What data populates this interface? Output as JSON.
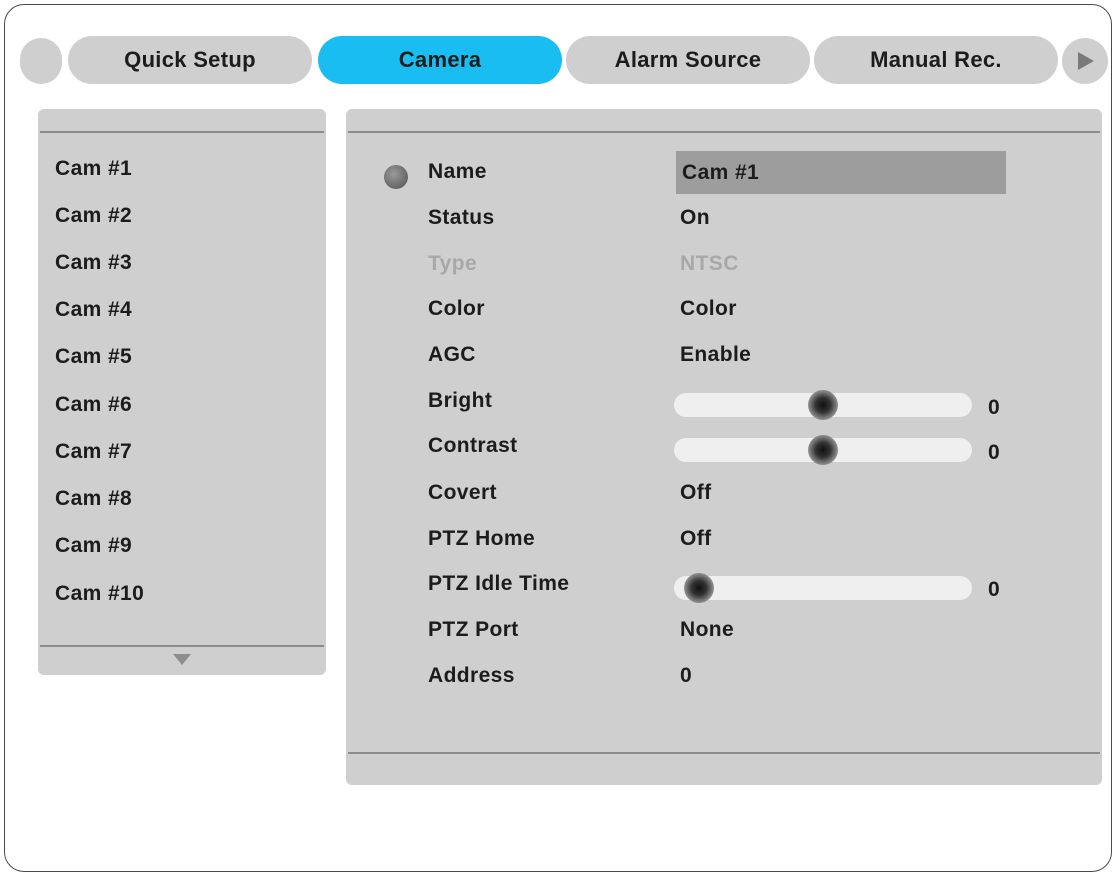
{
  "tabs": [
    {
      "label": "Quick Setup",
      "active": false
    },
    {
      "label": "Camera",
      "active": true
    },
    {
      "label": "Alarm Source",
      "active": false
    },
    {
      "label": "Manual Rec.",
      "active": false
    }
  ],
  "next_icon": "play-right-icon",
  "camera_list": [
    "Cam #1",
    "Cam #2",
    "Cam #3",
    "Cam #4",
    "Cam #5",
    "Cam #6",
    "Cam #7",
    "Cam #8",
    "Cam #9",
    "Cam #10"
  ],
  "settings": {
    "name": {
      "label": "Name",
      "value": "Cam #1"
    },
    "status": {
      "label": "Status",
      "value": "On"
    },
    "type": {
      "label": "Type",
      "value": "NTSC",
      "disabled": true
    },
    "color": {
      "label": "Color",
      "value": "Color"
    },
    "agc": {
      "label": "AGC",
      "value": "Enable"
    },
    "bright": {
      "label": "Bright",
      "value": "0",
      "level": 0.5
    },
    "contrast": {
      "label": "Contrast",
      "value": "0",
      "level": 0.5
    },
    "covert": {
      "label": "Covert",
      "value": "Off"
    },
    "ptz_home": {
      "label": "PTZ Home",
      "value": "Off"
    },
    "ptz_idle_time": {
      "label": "PTZ Idle Time",
      "value": "0",
      "level": 0.0
    },
    "ptz_port": {
      "label": "PTZ Port",
      "value": "None"
    },
    "address": {
      "label": "Address",
      "value": "0"
    }
  },
  "colors": {
    "active_tab": "#19bdf1",
    "tab": "#cfcfcf",
    "panel": "#cfcfcf",
    "selected_field": "#9d9d9d",
    "disabled_text": "#a8a8a8"
  }
}
